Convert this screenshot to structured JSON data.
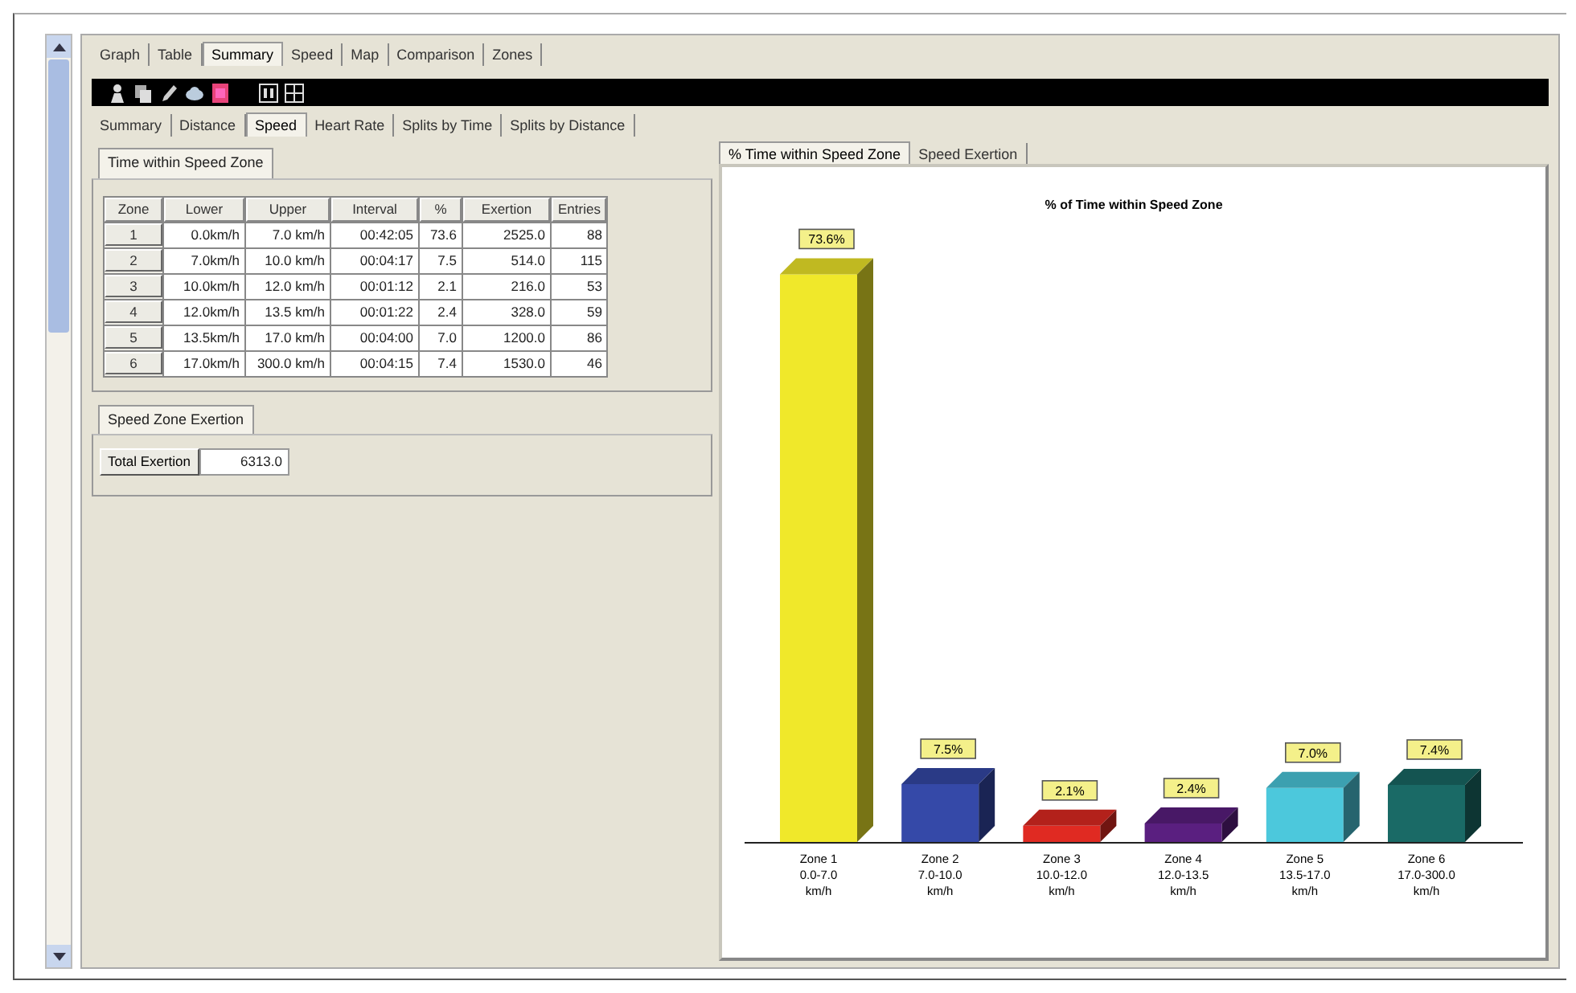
{
  "top_tabs": [
    {
      "label": "Graph",
      "selected": false
    },
    {
      "label": "Table",
      "selected": false
    },
    {
      "label": "Summary",
      "selected": true
    },
    {
      "label": "Speed",
      "selected": false
    },
    {
      "label": "Map",
      "selected": false
    },
    {
      "label": "Comparison",
      "selected": false
    },
    {
      "label": "Zones",
      "selected": false
    }
  ],
  "sub_tabs": [
    {
      "label": "Summary",
      "selected": false
    },
    {
      "label": "Distance",
      "selected": false
    },
    {
      "label": "Speed",
      "selected": true
    },
    {
      "label": "Heart Rate",
      "selected": false
    },
    {
      "label": "Splits by Time",
      "selected": false
    },
    {
      "label": "Splits by Distance",
      "selected": false
    }
  ],
  "zone_table": {
    "title": "Time within Speed Zone",
    "columns": [
      "Zone",
      "Lower",
      "Upper",
      "Interval",
      "%",
      "Exertion",
      "Entries"
    ],
    "rows": [
      [
        "1",
        "0.0km/h",
        "7.0 km/h",
        "00:42:05",
        "73.6",
        "2525.0",
        "88"
      ],
      [
        "2",
        "7.0km/h",
        "10.0 km/h",
        "00:04:17",
        "7.5",
        "514.0",
        "115"
      ],
      [
        "3",
        "10.0km/h",
        "12.0 km/h",
        "00:01:12",
        "2.1",
        "216.0",
        "53"
      ],
      [
        "4",
        "12.0km/h",
        "13.5 km/h",
        "00:01:22",
        "2.4",
        "328.0",
        "59"
      ],
      [
        "5",
        "13.5km/h",
        "17.0 km/h",
        "00:04:00",
        "7.0",
        "1200.0",
        "86"
      ],
      [
        "6",
        "17.0km/h",
        "300.0 km/h",
        "00:04:15",
        "7.4",
        "1530.0",
        "46"
      ]
    ]
  },
  "exertion": {
    "title": "Speed Zone Exertion",
    "label": "Total Exertion",
    "value": "6313.0"
  },
  "chart_tabs": [
    {
      "label": "% Time within Speed Zone",
      "selected": true
    },
    {
      "label": "Speed Exertion",
      "selected": false
    }
  ],
  "chart_data": {
    "type": "bar",
    "title": "% of Time within Speed Zone",
    "categories": [
      "Zone 1\n0.0-7.0\nkm/h",
      "Zone 2\n7.0-10.0\nkm/h",
      "Zone 3\n10.0-12.0\nkm/h",
      "Zone 4\n12.0-13.5\nkm/h",
      "Zone 5\n13.5-17.0\nkm/h",
      "Zone 6\n17.0-300.0\nkm/h"
    ],
    "values": [
      73.6,
      7.5,
      2.1,
      2.4,
      7.0,
      7.4
    ],
    "colors": [
      "#f0e82a",
      "#3549a8",
      "#e02a22",
      "#5a1f80",
      "#4cc8dc",
      "#1a6a66"
    ],
    "value_labels": [
      "73.6%",
      "7.5%",
      "2.1%",
      "2.4%",
      "7.0%",
      "7.4%"
    ]
  }
}
